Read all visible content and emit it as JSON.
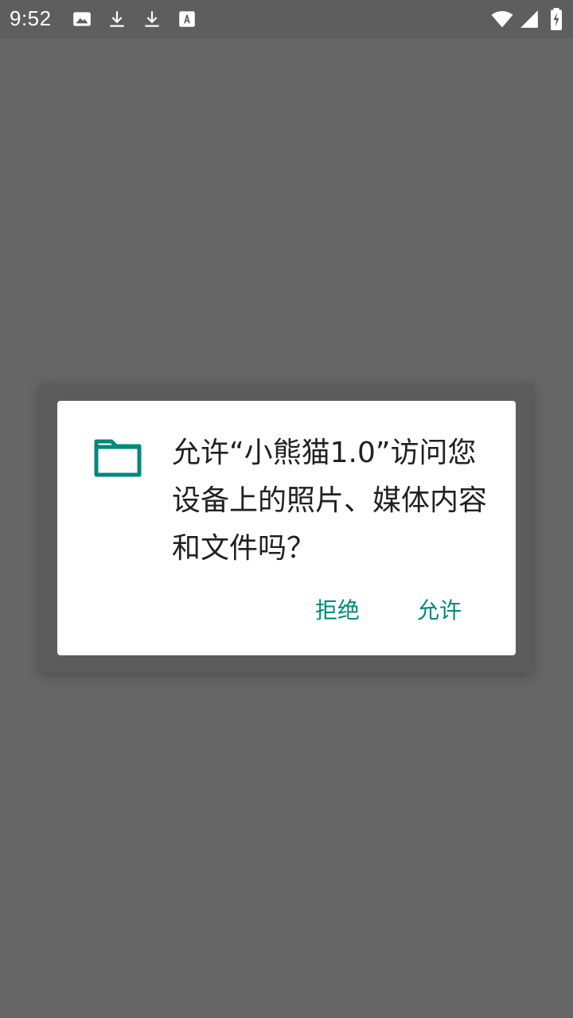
{
  "status_bar": {
    "time": "9:52",
    "left_icons": [
      "image-icon",
      "download-icon",
      "download-icon",
      "text-icon"
    ],
    "right_icons": [
      "wifi-icon",
      "signal-icon",
      "battery-charging-icon"
    ]
  },
  "dialog": {
    "icon": "folder-icon",
    "message": "允许“小熊猫1.0”访问您设备上的照片、媒体内容和文件吗？",
    "deny_label": "拒绝",
    "allow_label": "允许",
    "accent_color": "#00897b"
  }
}
